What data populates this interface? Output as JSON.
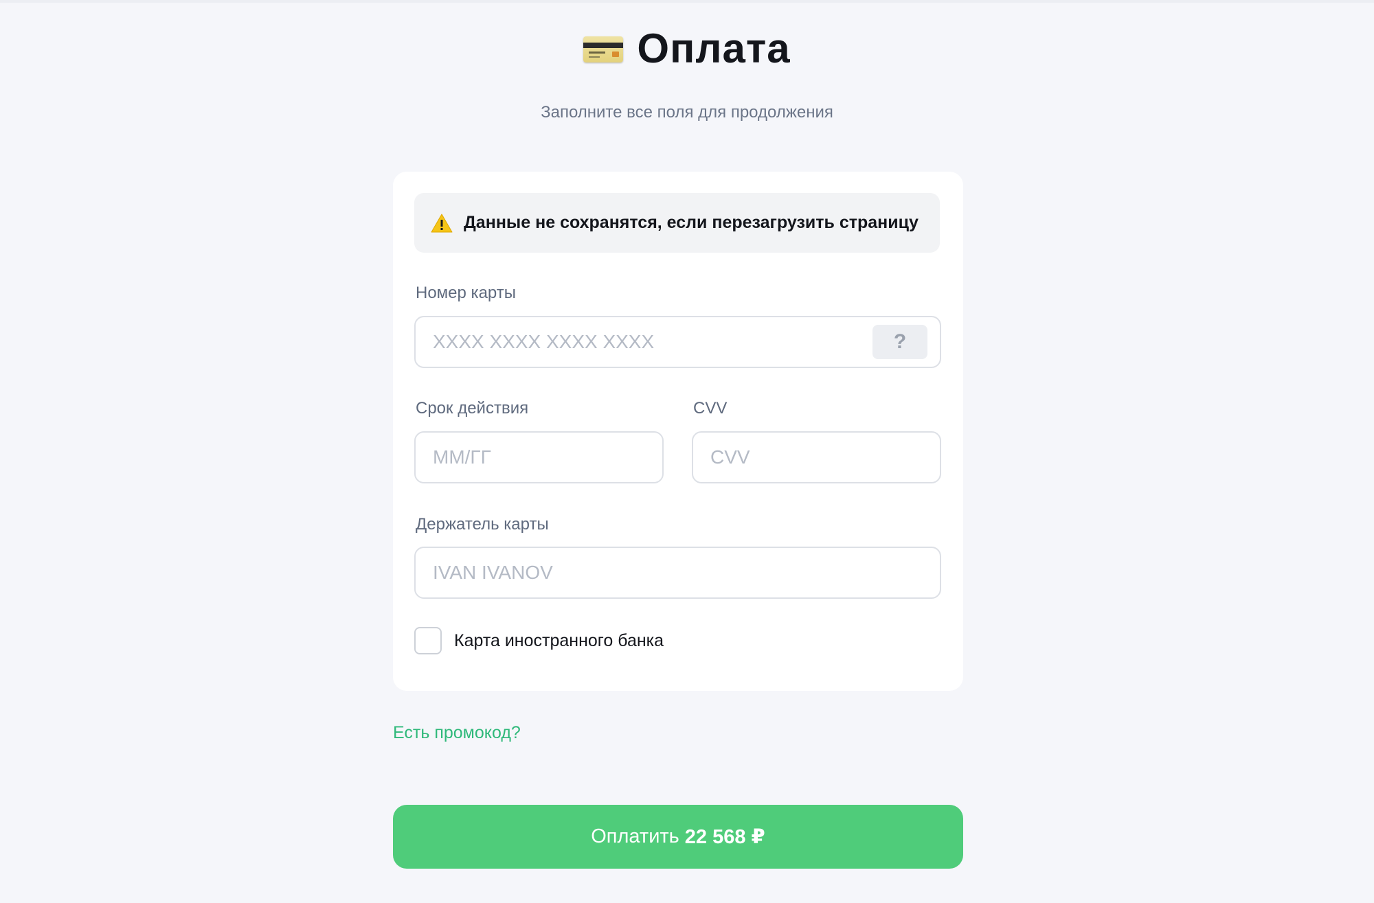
{
  "header": {
    "title": "Оплата",
    "subtitle": "Заполните все поля для продолжения",
    "title_icon": "credit-card-icon"
  },
  "alert": {
    "icon": "warning-icon",
    "text": "Данные не сохранятся, если перезагрузить страницу"
  },
  "form": {
    "card_number": {
      "label": "Номер карты",
      "placeholder": "XXXX XXXX XXXX XXXX",
      "value": "",
      "help": "?"
    },
    "expiry": {
      "label": "Срок действия",
      "placeholder": "ММ/ГГ",
      "value": ""
    },
    "cvv": {
      "label": "CVV",
      "placeholder": "CVV",
      "value": ""
    },
    "holder": {
      "label": "Держатель карты",
      "placeholder": "IVAN IVANOV",
      "value": ""
    },
    "foreign_bank": {
      "label": "Карта иностранного банка",
      "checked": false
    }
  },
  "promo_link": "Есть промокод?",
  "pay_button": {
    "label": "Оплатить",
    "amount": "22 568 ₽"
  },
  "colors": {
    "accent": "#4fcc7a",
    "link": "#2fb97a",
    "background": "#f5f6fa",
    "card": "#ffffff",
    "warning": "#f5c518"
  }
}
